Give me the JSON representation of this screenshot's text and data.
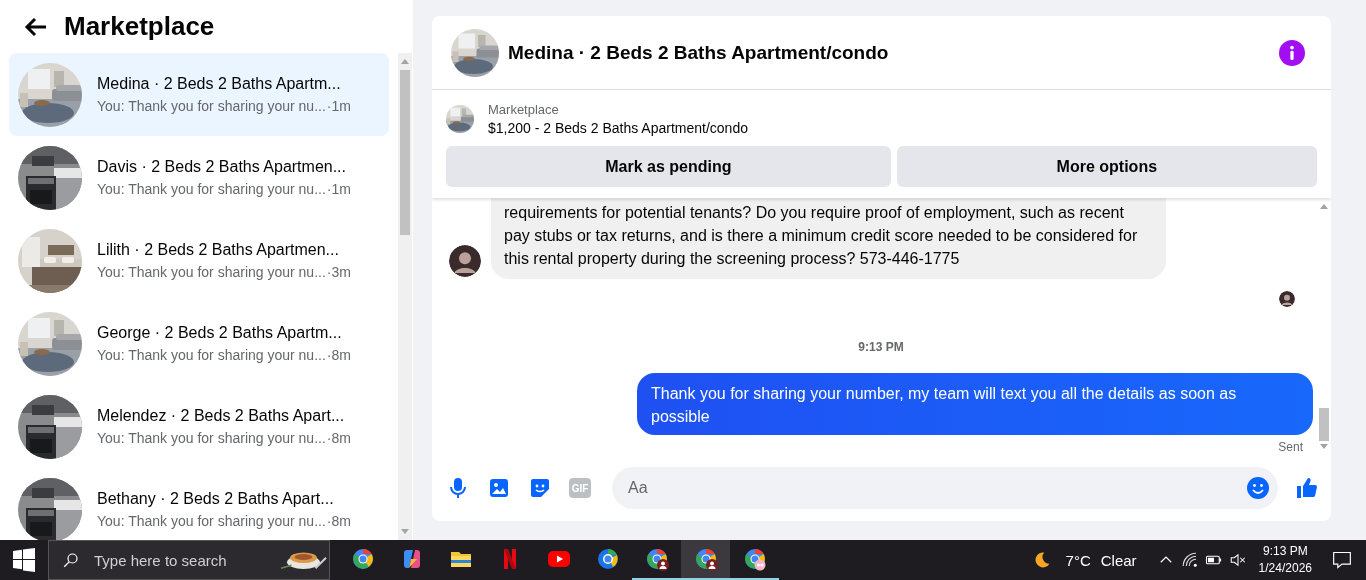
{
  "sidebar": {
    "title": "Marketplace",
    "conversations": [
      {
        "name": "Medina · 2 Beds 2 Baths Apartm...",
        "preview": "You: Thank you for sharing your nu...",
        "time": "·1m",
        "selected": true
      },
      {
        "name": "Davis · 2 Beds 2 Baths Apartmen...",
        "preview": "You: Thank you for sharing your nu...",
        "time": "·1m",
        "selected": false
      },
      {
        "name": "Lilith · 2 Beds 2 Baths Apartmen...",
        "preview": "You: Thank you for sharing your nu...",
        "time": "·3m",
        "selected": false
      },
      {
        "name": "George · 2 Beds 2 Baths Apartm...",
        "preview": "You: Thank you for sharing your nu...",
        "time": "·8m",
        "selected": false
      },
      {
        "name": "Melendez · 2 Beds 2 Baths Apart...",
        "preview": "You: Thank you for sharing your nu...",
        "time": "·8m",
        "selected": false
      },
      {
        "name": "Bethany · 2 Beds 2 Baths Apart...",
        "preview": "You: Thank you for sharing your nu...",
        "time": "·8m",
        "selected": false
      }
    ]
  },
  "chat": {
    "title": "Medina · 2 Beds 2 Baths Apartment/condo",
    "listing": {
      "source": "Marketplace",
      "title": "$1,200 - 2 Beds 2 Baths Apartment/condo"
    },
    "actions": [
      "Mark as pending",
      "More options"
    ],
    "messages": [
      {
        "kind": "incoming",
        "text": "requirements for potential tenants? Do you require proof of employment, such as recent pay stubs or tax returns, and is there a minimum credit score needed to be considered for this rental property during the screening process? 573-446-1775"
      },
      {
        "kind": "seen"
      },
      {
        "kind": "timestamp",
        "text": "9:13 PM"
      },
      {
        "kind": "outgoing",
        "text": "Thank you for  sharing your number, my team will text you all the details as soon as possible",
        "status": "Sent"
      }
    ],
    "composer": {
      "gif_label": "GIF",
      "placeholder": "Aa"
    }
  },
  "taskbar": {
    "search_placeholder": "Type here to search",
    "apps": [
      {
        "kind": "browser",
        "running": false,
        "selected": false
      },
      {
        "kind": "swirl",
        "running": false,
        "selected": false
      },
      {
        "kind": "folder",
        "running": false,
        "selected": false
      },
      {
        "kind": "stripes",
        "running": false,
        "selected": false
      },
      {
        "kind": "play",
        "running": false,
        "selected": false
      },
      {
        "kind": "ring",
        "running": false,
        "selected": false
      },
      {
        "kind": "ring-person",
        "running": true,
        "selected": false
      },
      {
        "kind": "ring-person",
        "running": true,
        "selected": true
      },
      {
        "kind": "browser-badge",
        "running": true,
        "selected": false
      }
    ],
    "weather": {
      "temperature": "7°C",
      "condition": "Clear"
    },
    "time": "9:13 PM",
    "date": "1/24/2026"
  }
}
